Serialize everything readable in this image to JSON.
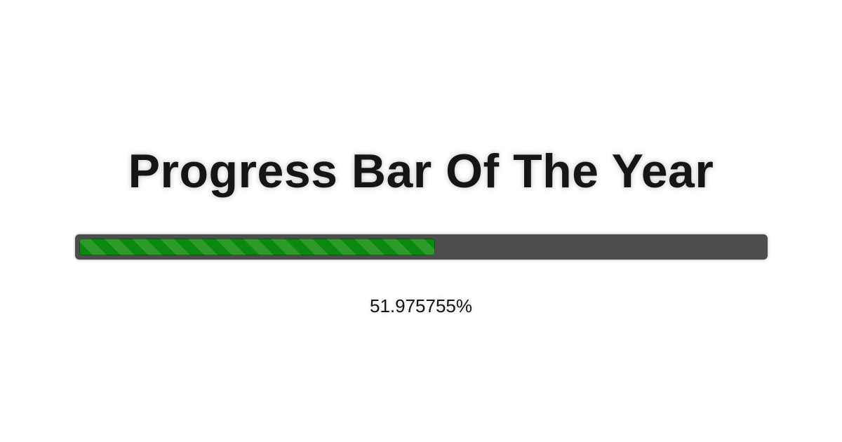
{
  "header": {
    "title": "Progress Bar Of The Year"
  },
  "progress": {
    "percent_label": "51.975755%",
    "fraction": 0.51975755,
    "fill_color": "#0a880f",
    "stripe_color": "#2f9a2c",
    "track_color": "#4d4d4d"
  }
}
